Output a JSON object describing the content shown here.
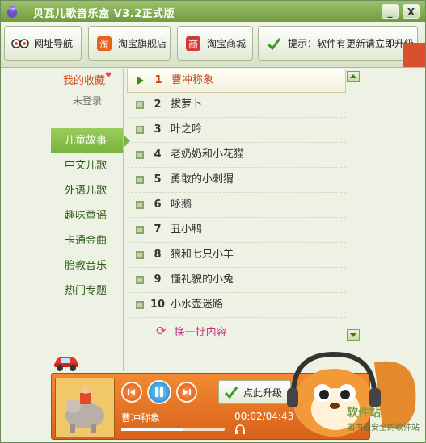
{
  "app": {
    "title": "贝瓦儿歌音乐盒 V3.2正式版",
    "window_buttons": {
      "minimize": "_",
      "close": "X"
    }
  },
  "toolbar": {
    "buttons": [
      {
        "label": "网址导航",
        "icon": "glasses-icon"
      },
      {
        "label": "淘宝旗舰店",
        "icon": "taobao-icon"
      },
      {
        "label": "淘宝商城",
        "icon": "mall-icon"
      },
      {
        "label": "提示：软件有更新请立即升级",
        "icon": "check-icon"
      }
    ]
  },
  "sidebar": {
    "favorites": {
      "title": "我的收藏",
      "heart": "♥",
      "status": "未登录"
    },
    "categories": [
      {
        "label": "儿童故事",
        "active": true
      },
      {
        "label": "中文儿歌",
        "active": false
      },
      {
        "label": "外语儿歌",
        "active": false
      },
      {
        "label": "趣味童谣",
        "active": false
      },
      {
        "label": "卡通金曲",
        "active": false
      },
      {
        "label": "胎教音乐",
        "active": false
      },
      {
        "label": "热门专题",
        "active": false
      }
    ]
  },
  "playlist": {
    "items": [
      {
        "num": "1",
        "title": "曹冲称象",
        "selected": true
      },
      {
        "num": "2",
        "title": "拔萝卜",
        "selected": false
      },
      {
        "num": "3",
        "title": "叶之吟",
        "selected": false
      },
      {
        "num": "4",
        "title": "老奶奶和小花猫",
        "selected": false
      },
      {
        "num": "5",
        "title": "勇敢的小刺猬",
        "selected": false
      },
      {
        "num": "6",
        "title": "咏鹅",
        "selected": false
      },
      {
        "num": "7",
        "title": "丑小鸭",
        "selected": false
      },
      {
        "num": "8",
        "title": "狼和七只小羊",
        "selected": false
      },
      {
        "num": "9",
        "title": "懂礼貌的小兔",
        "selected": false
      },
      {
        "num": "10",
        "title": "小水壶迷路",
        "selected": false
      }
    ],
    "refresh_label": "换一批内容"
  },
  "player": {
    "now_playing": "曹冲称象",
    "time": "00:02/04:43",
    "progress": 0.6,
    "upgrade_label": "点此升级"
  },
  "watermark": {
    "line1": "软件站",
    "line2": "国内最安全的软件站"
  },
  "colors": {
    "titlebar": "#7faa4a",
    "accent_green": "#78b23c",
    "player_orange": "#e8731f",
    "selected_text": "#c43d10",
    "refresh_text": "#c82f7a"
  }
}
